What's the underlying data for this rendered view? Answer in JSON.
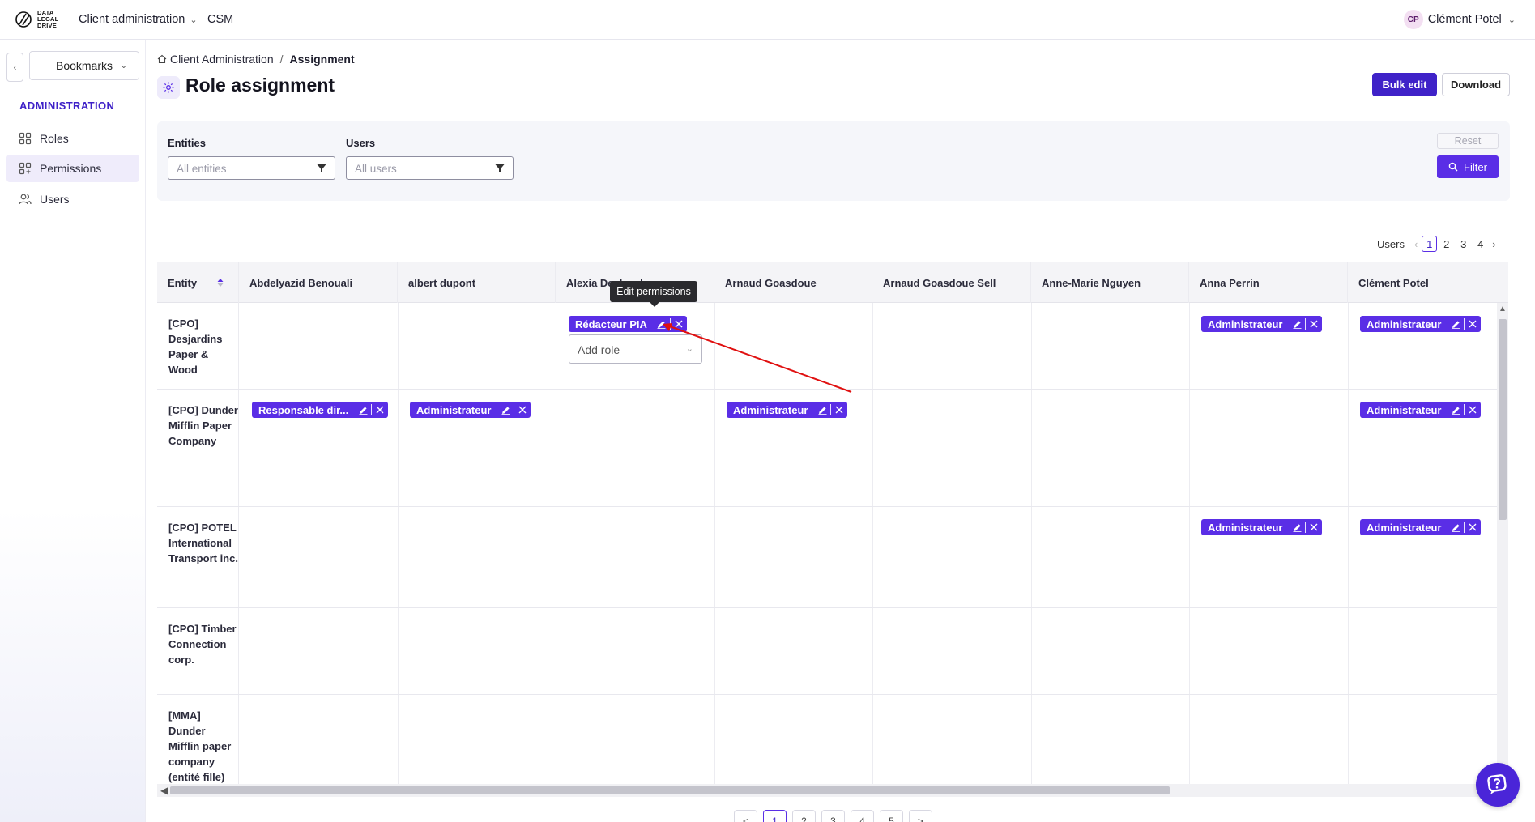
{
  "topbar": {
    "logo_text": [
      "DATA",
      "LEGAL",
      "DRIVE"
    ],
    "nav_client": "Client administration",
    "nav_csm": "CSM",
    "user_initials": "CP",
    "user_name": "Clément Potel"
  },
  "sidebar": {
    "bookmarks": "Bookmarks",
    "section_title": "ADMINISTRATION",
    "items": [
      {
        "label": "Roles",
        "icon": "grid-icon"
      },
      {
        "label": "Permissions",
        "icon": "grid-plus-icon",
        "active": true
      },
      {
        "label": "Users",
        "icon": "users-icon"
      }
    ]
  },
  "breadcrumb": {
    "root": "Client Administration",
    "separator": "/",
    "current": "Assignment"
  },
  "page": {
    "title": "Role assignment",
    "bulk_edit": "Bulk edit",
    "download": "Download"
  },
  "filters": {
    "entities_label": "Entities",
    "entities_placeholder": "All entities",
    "users_label": "Users",
    "users_placeholder": "All users",
    "reset": "Reset",
    "filter": "Filter"
  },
  "pagination_top": {
    "label": "Users",
    "pages": [
      "1",
      "2",
      "3",
      "4"
    ],
    "current": "1"
  },
  "grid": {
    "entity_header": "Entity",
    "columns": [
      "Abdelyazid Benouali",
      "albert dupont",
      "Alexia Desbordes",
      "Arnaud Goasdoue",
      "Arnaud Goasdoue Sell",
      "Anne-Marie Nguyen",
      "Anna Perrin",
      "Clément Potel"
    ],
    "rows": [
      {
        "entity": "[CPO] Desjardins Paper & Wood",
        "roles": [
          "",
          "",
          "Rédacteur PIA",
          "",
          "",
          "",
          "Administrateur",
          "Administrateur"
        ]
      },
      {
        "entity": "[CPO] Dunder Mifflin Paper Company",
        "roles": [
          "Responsable dir...",
          "Administrateur",
          "",
          "Administrateur",
          "",
          "",
          "",
          "Administrateur"
        ]
      },
      {
        "entity": "[CPO] POTEL International Transport inc.",
        "roles": [
          "",
          "",
          "",
          "",
          "",
          "",
          "Administrateur",
          "Administrateur"
        ]
      },
      {
        "entity": "[CPO] Timber Connection corp.",
        "roles": [
          "",
          "",
          "",
          "",
          "",
          "",
          "",
          ""
        ]
      },
      {
        "entity": "[MMA] Dunder Mifflin paper company (entité fille)",
        "roles": [
          "",
          "",
          "",
          "",
          "",
          "",
          "",
          ""
        ]
      }
    ],
    "add_role_placeholder": "Add role",
    "tooltip": "Edit permissions"
  },
  "pagination_bottom": {
    "prev": "<",
    "pages": [
      "1",
      "2",
      "3",
      "4",
      "5"
    ],
    "current": "1",
    "next": ">"
  },
  "colors": {
    "accent": "#5a2ee6",
    "primary_button": "#3f22c8",
    "annotation_arrow": "#e01010"
  }
}
